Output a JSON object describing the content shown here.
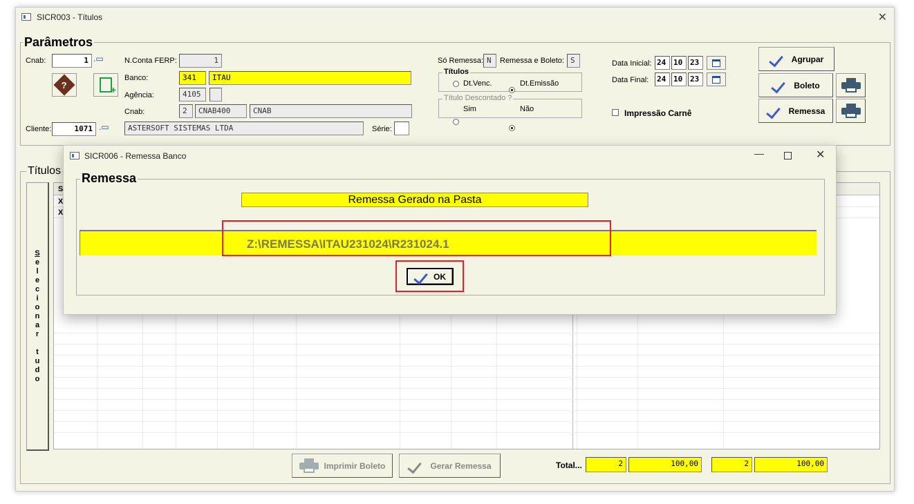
{
  "window": {
    "title": "SICR003 - Títulos"
  },
  "params": {
    "title": "Parâmetros",
    "cnab_label": "Cnab:",
    "cnab_value": "1",
    "n_conta_label": "N.Conta FERP:",
    "n_conta_value": "1",
    "banco_label": "Banco:",
    "banco_code": "341",
    "banco_name": "ITAU",
    "agencia_label": "Agência:",
    "agencia_value": "4105",
    "agencia_dv": "",
    "cnab2_label": "Cnab:",
    "cnab2_code": "2",
    "cnab2_layout": "CNAB400",
    "cnab2_name": "CNAB",
    "cliente_label": "Cliente:",
    "cliente_code": "1071",
    "cliente_name": "ASTERSOFT SISTEMAS LTDA",
    "serie_label": "Série:",
    "serie_value": "",
    "so_remessa_label": "Só Remessa:",
    "so_remessa_value": "N",
    "remessa_boleto_label": "Remessa e Boleto:",
    "remessa_boleto_value": "S",
    "titulos_group": "Títulos",
    "dt_venc": "Dt.Venc.",
    "dt_emissao": "Dt.Emissão",
    "descontado_group": "Título Descontado ?",
    "sim": "Sim",
    "nao": "Não",
    "data_inicial_label": "Data Inicial:",
    "data_inicial": [
      "24",
      "10",
      "23"
    ],
    "data_final_label": "Data Final:",
    "data_final": [
      "24",
      "10",
      "23"
    ],
    "impressao_carne": "Impressão Carnê"
  },
  "actions": {
    "agrupar": "Agrupar",
    "boleto": "Boleto",
    "remessa": "Remessa"
  },
  "titulos": {
    "title": "Títulos",
    "selecionar_tudo": [
      "S",
      "e",
      "l",
      "e",
      "c",
      "i",
      "o",
      "n",
      "a",
      "r",
      "",
      "t",
      "u",
      "d",
      "o"
    ],
    "col1_header": "S",
    "rows": [
      "X",
      "X"
    ]
  },
  "footer": {
    "imprimir_boleto": "Imprimir Boleto",
    "gerar_remessa": "Gerar Remessa",
    "total_label": "Total...",
    "total1_count": "2",
    "total1_value": "100,00",
    "total2_count": "2",
    "total2_value": "100,00"
  },
  "dialog": {
    "title": "SICR006 - Remessa Banco",
    "group": "Remessa",
    "message": "Remessa Gerado na Pasta",
    "path": "Z:\\REMESSA\\ITAU231024\\R231024.1",
    "ok": "OK"
  },
  "colors": {
    "highlight": "#ffff00",
    "accent": "#3a5ad0",
    "annotation": "#e0202a"
  }
}
